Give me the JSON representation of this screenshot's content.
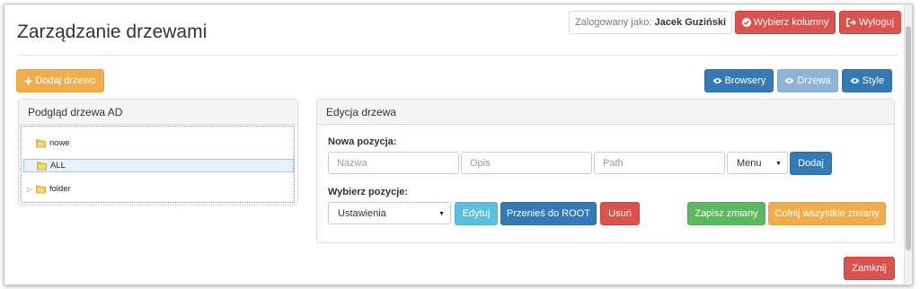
{
  "header": {
    "title": "Zarządzanie drzewami",
    "login_prefix": "Zalogowany jako:",
    "login_user": "Jacek Guziński",
    "select_columns_label": "Wybierz kolumny",
    "logout_label": "Wyloguj"
  },
  "toolbar": {
    "add_tree_label": "Dodaj drzewo",
    "view_buttons": [
      "Browsery",
      "Drzewa",
      "Style"
    ]
  },
  "tree_panel": {
    "title": "Podgląd drzewa AD",
    "nodes": [
      {
        "label": "nowe",
        "expandable": false,
        "selected": false
      },
      {
        "label": "ALL",
        "expandable": false,
        "selected": true
      },
      {
        "label": "folder",
        "expandable": true,
        "selected": false
      }
    ]
  },
  "edit_panel": {
    "title": "Edycja drzewa",
    "new_position_label": "Nowa pozycja:",
    "name_placeholder": "Nazwa",
    "desc_placeholder": "Opis",
    "path_placeholder": "Path",
    "type_select_value": "Menu",
    "add_label": "Dodaj",
    "choose_position_label": "Wybierz pozycje:",
    "position_select_value": "Ustawienia",
    "edit_label": "Edytuj",
    "move_root_label": "Przenieś do ROOT",
    "delete_label": "Usuń",
    "save_label": "Zapisz zmiany",
    "revert_label": "Cofnij wszystkie zmiany"
  },
  "footer": {
    "close_label": "Zamknij"
  },
  "colors": {
    "danger": "#d9534f",
    "warning": "#f0ad4e",
    "primary": "#337ab7",
    "info": "#5bc0de",
    "success": "#5cb85c",
    "folder": "#e8c048"
  }
}
